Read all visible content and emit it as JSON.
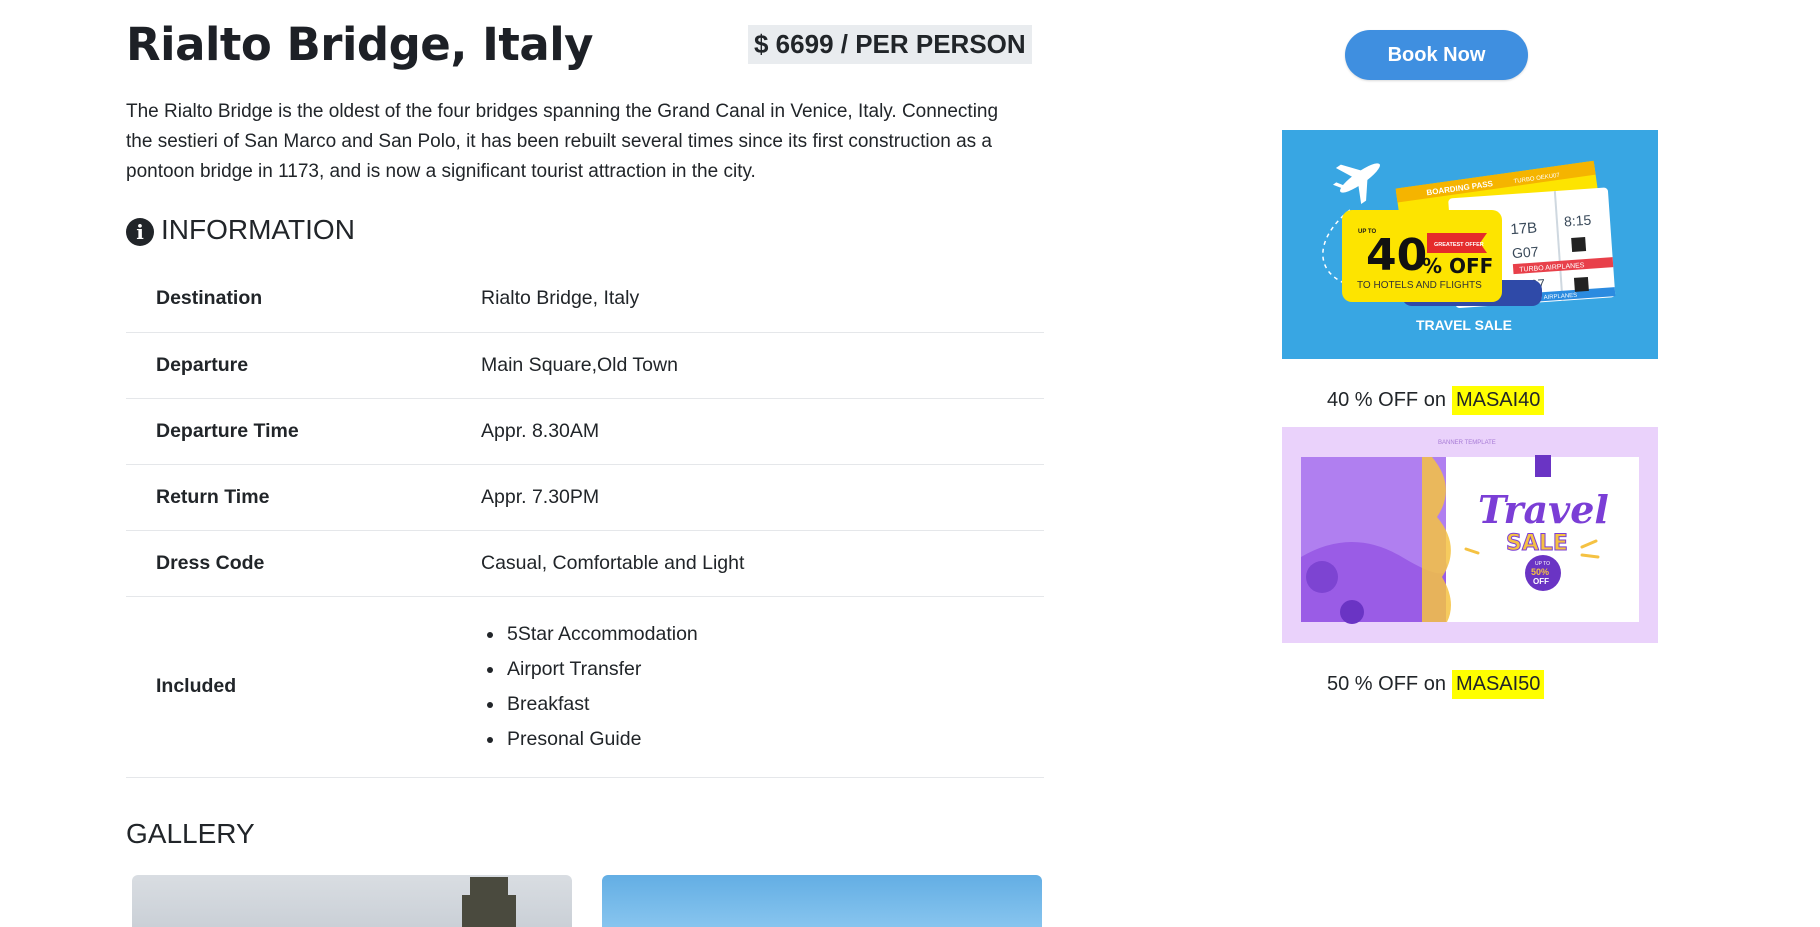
{
  "tour": {
    "title": "Rialto Bridge, Italy",
    "price": "$ 6699 / PER PERSON",
    "description": "The Rialto Bridge is the oldest of the four bridges spanning the Grand Canal in Venice, Italy. Connecting the sestieri of San Marco and San Polo, it has been rebuilt several times since its first construction as a pontoon bridge in 1173, and is now a significant tourist attraction in the city."
  },
  "information": {
    "heading": "INFORMATION",
    "icon": "info-circle-icon",
    "rows": [
      {
        "key": "Destination",
        "value": "Rialto Bridge, Italy"
      },
      {
        "key": "Departure",
        "value": "Main Square,Old Town"
      },
      {
        "key": "Departure Time",
        "value": "Appr. 8.30AM"
      },
      {
        "key": "Return Time",
        "value": "Appr. 7.30PM"
      },
      {
        "key": "Dress Code",
        "value": "Casual, Comfortable and Light"
      }
    ],
    "included": {
      "key": "Included",
      "items": [
        "5Star Accommodation",
        "Airport Transfer",
        "Breakfast",
        "Presonal Guide"
      ]
    }
  },
  "gallery": {
    "heading": "GALLERY"
  },
  "sidebar": {
    "book_label": "Book Now",
    "offers": [
      {
        "banner": {
          "boarding_pass": "BOARDING PASS",
          "turbo_top": "TURBO OEKU07",
          "up_to": "UP TO",
          "big_number": "40",
          "percent_off": "% OFF",
          "greatest_offer": "GREATEST OFFER",
          "subtitle": "TO HOTELS AND FLIGHTS",
          "seat": "17B",
          "time": "8:15",
          "gate": "G07",
          "gate2": "G07",
          "airplanes": "TURBO AIRPLANES",
          "airplanes2": "TURBO AIRPLANES",
          "sale_title": "TRAVEL SALE"
        },
        "text": "40 % OFF on",
        "code": "MASAI40"
      },
      {
        "banner": {
          "template_label": "BANNER TEMPLATE",
          "travel": "Travel",
          "sale": "SALE",
          "up_to": "UP TO",
          "percent": "50%",
          "off": "OFF"
        },
        "text": "50 % OFF on",
        "code": "MASAI50"
      }
    ]
  },
  "colors": {
    "book_button": "#3f8fe0",
    "coupon_highlight": "#ffff00",
    "ad1_bg": "#38a6e3",
    "ad1_yellow": "#fde400",
    "ad2_bg": "#ead2fb",
    "ad2_purple": "#9a5ce6"
  }
}
